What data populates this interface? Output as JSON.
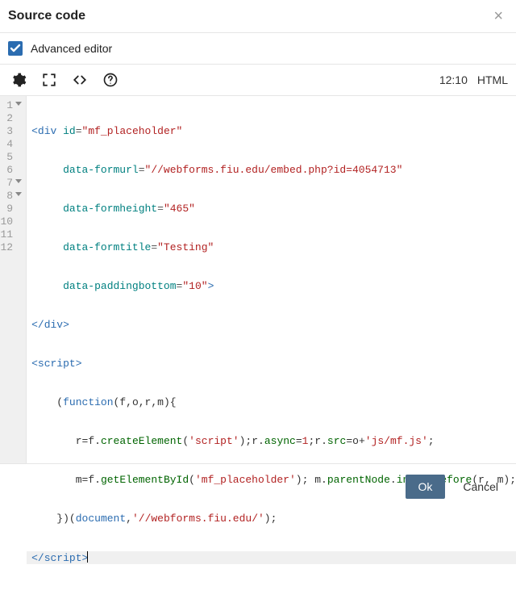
{
  "header": {
    "title": "Source code"
  },
  "adv": {
    "label": "Advanced editor",
    "checked": true
  },
  "toolbar": {
    "cursor_pos": "12:10",
    "lang": "HTML"
  },
  "footer": {
    "ok": "Ok",
    "cancel": "Cancel"
  },
  "lines": [
    1,
    2,
    3,
    4,
    5,
    6,
    7,
    8,
    9,
    10,
    11,
    12
  ],
  "foldable": [
    1,
    7,
    8
  ],
  "active_line": 12,
  "code": {
    "tag_div": "div",
    "tag_script": "script",
    "attr_id": "id",
    "attr_dataformurl": "data-formurl",
    "attr_dataformheight": "data-formheight",
    "attr_dataformtitle": "data-formtitle",
    "attr_datapaddingbottom": "data-paddingbottom",
    "val_id": "\"mf_placeholder\"",
    "val_formurl": "\"//webforms.fiu.edu/embed.php?id=4054713\"",
    "val_formheight": "\"465\"",
    "val_formtitle": "\"Testing\"",
    "val_paddingbottom": "\"10\"",
    "kw_function": "function",
    "fn_createElement": "createElement",
    "fn_getElementById": "getElementById",
    "fn_insertBefore": "insertBefore",
    "var_document": "document",
    "prop_async": "async",
    "prop_src": "src",
    "prop_parentNode": "parentNode",
    "str_script": "'script'",
    "str_jsmf": "'js/mf.js'",
    "str_mfph": "'mf_placeholder'",
    "str_wfurl": "'//webforms.fiu.edu/'",
    "num_1": "1",
    "p_open": "(",
    "p_close": ")",
    "brace_open": "{",
    "brace_close": "}",
    "semi": ";",
    "dot": ".",
    "eq": "=",
    "plus": "+",
    "comma": ",",
    "space": " ",
    "lt": "<",
    "gt": ">",
    "slash": "/",
    "params": "f,o,r,m",
    "r": "r",
    "f": "f",
    "m": "m",
    "o": "o",
    "ind1": "     ",
    "ind2": "    ",
    "ind3": "       ",
    "ind4": "        "
  }
}
